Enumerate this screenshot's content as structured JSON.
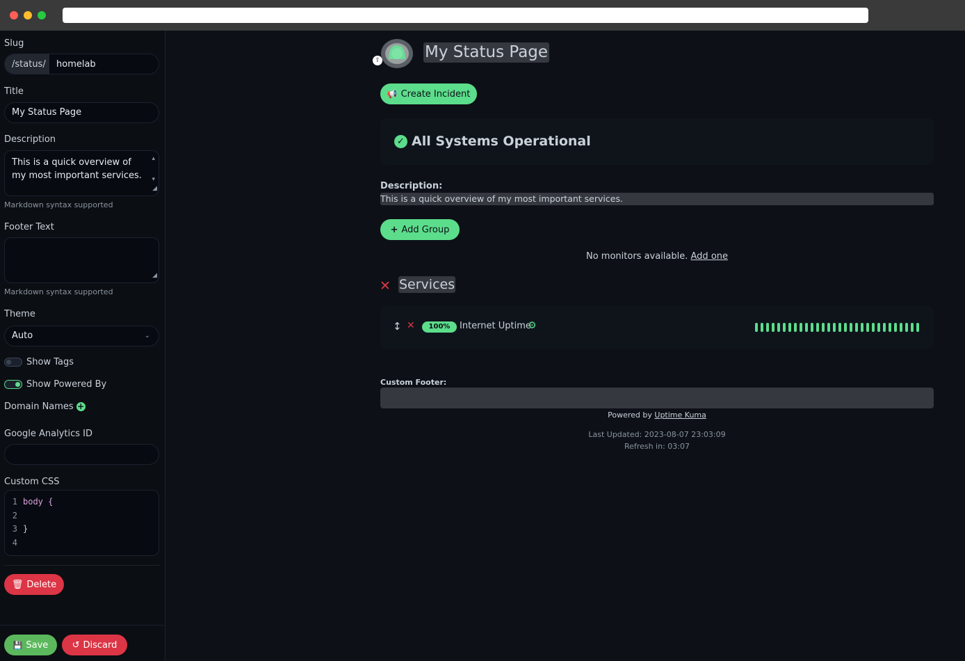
{
  "sidebar": {
    "slug_label": "Slug",
    "slug_prefix": "/status/",
    "slug_value": "homelab",
    "title_label": "Title",
    "title_value": "My Status Page",
    "description_label": "Description",
    "description_value": "This is a quick overview of my most important services.",
    "markdown_hint": "Markdown syntax supported",
    "footer_label": "Footer Text",
    "footer_value": "",
    "theme_label": "Theme",
    "theme_value": "Auto",
    "show_tags_label": "Show Tags",
    "show_tags_on": false,
    "show_powered_label": "Show Powered By",
    "show_powered_on": true,
    "domain_names_label": "Domain Names",
    "ga_label": "Google Analytics ID",
    "ga_value": "",
    "css_label": "Custom CSS",
    "css_lines": [
      {
        "num": "1",
        "text": "body {"
      },
      {
        "num": "2",
        "text": ""
      },
      {
        "num": "3",
        "text": "}"
      },
      {
        "num": "4",
        "text": ""
      }
    ],
    "delete_label": "Delete",
    "save_label": "Save",
    "discard_label": "Discard"
  },
  "main": {
    "title": "My Status Page",
    "create_incident_label": "Create Incident",
    "overall_status": "All Systems Operational",
    "description_label": "Description:",
    "description": "This is a quick overview of my most important services.",
    "add_group_label": "Add Group",
    "no_monitors_text": "No monitors available.",
    "add_one_link": "Add one",
    "group_name": "Services",
    "monitor": {
      "uptime_badge": "100%",
      "name": "Internet Uptime",
      "heartbeats": 30
    },
    "custom_footer_label": "Custom Footer:",
    "powered_by_text": "Powered by",
    "powered_by_link": "Uptime Kuma",
    "last_updated": "Last Updated: 2023-08-07 23:03:09",
    "refresh_in": "Refresh in: 03:07"
  },
  "colors": {
    "accent": "#5cdd8b",
    "danger": "#dc3545",
    "save": "#5cb85c",
    "background": "#0d1117"
  }
}
